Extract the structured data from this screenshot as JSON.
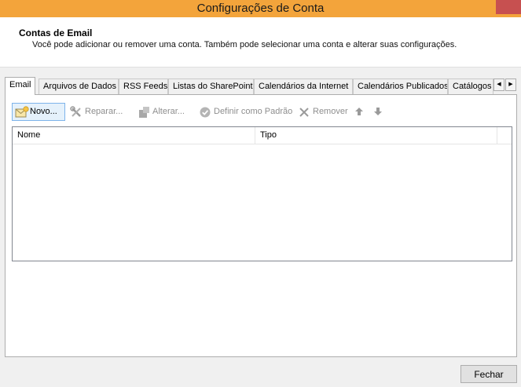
{
  "window": {
    "title": "Configurações de Conta"
  },
  "header": {
    "title": "Contas de Email",
    "description": "Você pode adicionar ou remover uma conta. Também pode selecionar uma conta e alterar suas configurações."
  },
  "tabs": [
    {
      "label": "Email",
      "active": true
    },
    {
      "label": "Arquivos de Dados"
    },
    {
      "label": "RSS Feeds"
    },
    {
      "label": "Listas do SharePoint"
    },
    {
      "label": "Calendários da Internet"
    },
    {
      "label": "Calendários Publicados"
    },
    {
      "label": "Catálogos"
    }
  ],
  "toolbar": {
    "new_label": "Novo...",
    "repair_label": "Reparar...",
    "change_label": "Alterar...",
    "set_default_label": "Definir como Padrão",
    "remove_label": "Remover"
  },
  "list": {
    "columns": [
      "Nome",
      "Tipo"
    ],
    "rows": []
  },
  "footer": {
    "close_label": "Fechar"
  },
  "colors": {
    "titlebar": "#f3a43b",
    "close_button": "#c75050",
    "selection": "#e5f1fb"
  }
}
